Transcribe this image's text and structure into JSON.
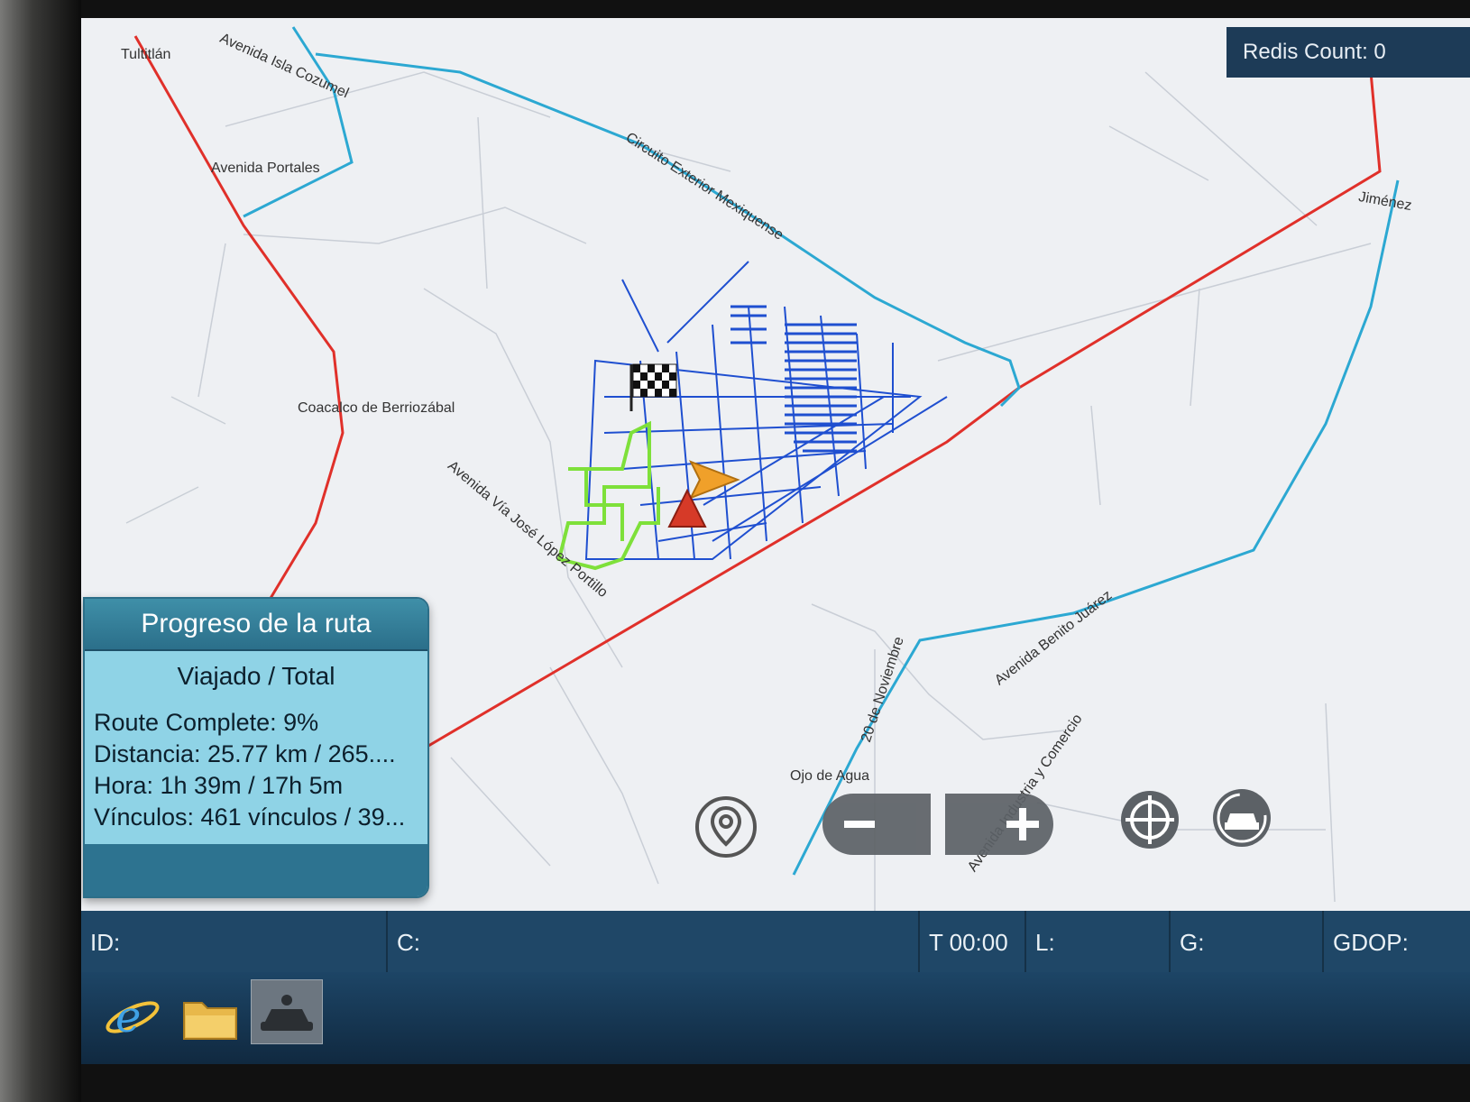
{
  "redis": {
    "label": "Redis Count: 0"
  },
  "map": {
    "labels": [
      {
        "text": "Tultitlán"
      },
      {
        "text": "Avenida Isla Cozumel"
      },
      {
        "text": "Avenida Portales"
      },
      {
        "text": "Circuito Exterior Mexiquense"
      },
      {
        "text": "Jiménez"
      },
      {
        "text": "Coacalco de Berriozábal"
      },
      {
        "text": "Avenida Vía José López Portillo"
      },
      {
        "text": "Avenida Benito Juárez"
      },
      {
        "text": "20 de Noviembre"
      },
      {
        "text": "Avenida Industria y Comercio"
      },
      {
        "text": "Ojo de Agua"
      }
    ],
    "markers": {
      "finish": "checkered-flag-icon",
      "vehicle": "orange-arrow-icon",
      "start": "red-triangle-icon"
    }
  },
  "progress": {
    "title": "Progreso de la ruta",
    "subtitle": "Viajado / Total",
    "rows": [
      "Route Complete: 9%",
      "Distancia: 25.77 km / 265....",
      "Hora: 1h 39m / 17h 5m",
      "Vínculos: 461 vínculos / 39..."
    ],
    "percent_complete": 9
  },
  "controls": {
    "pin": "map-pin-icon",
    "zoom_out": "minus-icon",
    "zoom_in": "plus-icon",
    "center": "crosshair-icon",
    "vehicle": "car-icon"
  },
  "status": {
    "id_label": "ID:",
    "c_label": "C:",
    "time_label": "T 00:00",
    "l_label": "L:",
    "g_label": "G:",
    "gdop_label": "GDOP:"
  },
  "taskbar": {
    "apps": [
      "internet-explorer-icon",
      "file-explorer-icon",
      "navigation-app-icon"
    ]
  },
  "colors": {
    "highway": "#e0302a",
    "arterial": "#2ca8d2",
    "route_network": "#1f4fd0",
    "traveled": "#7ee03a",
    "panel": "#8fd3e6"
  }
}
